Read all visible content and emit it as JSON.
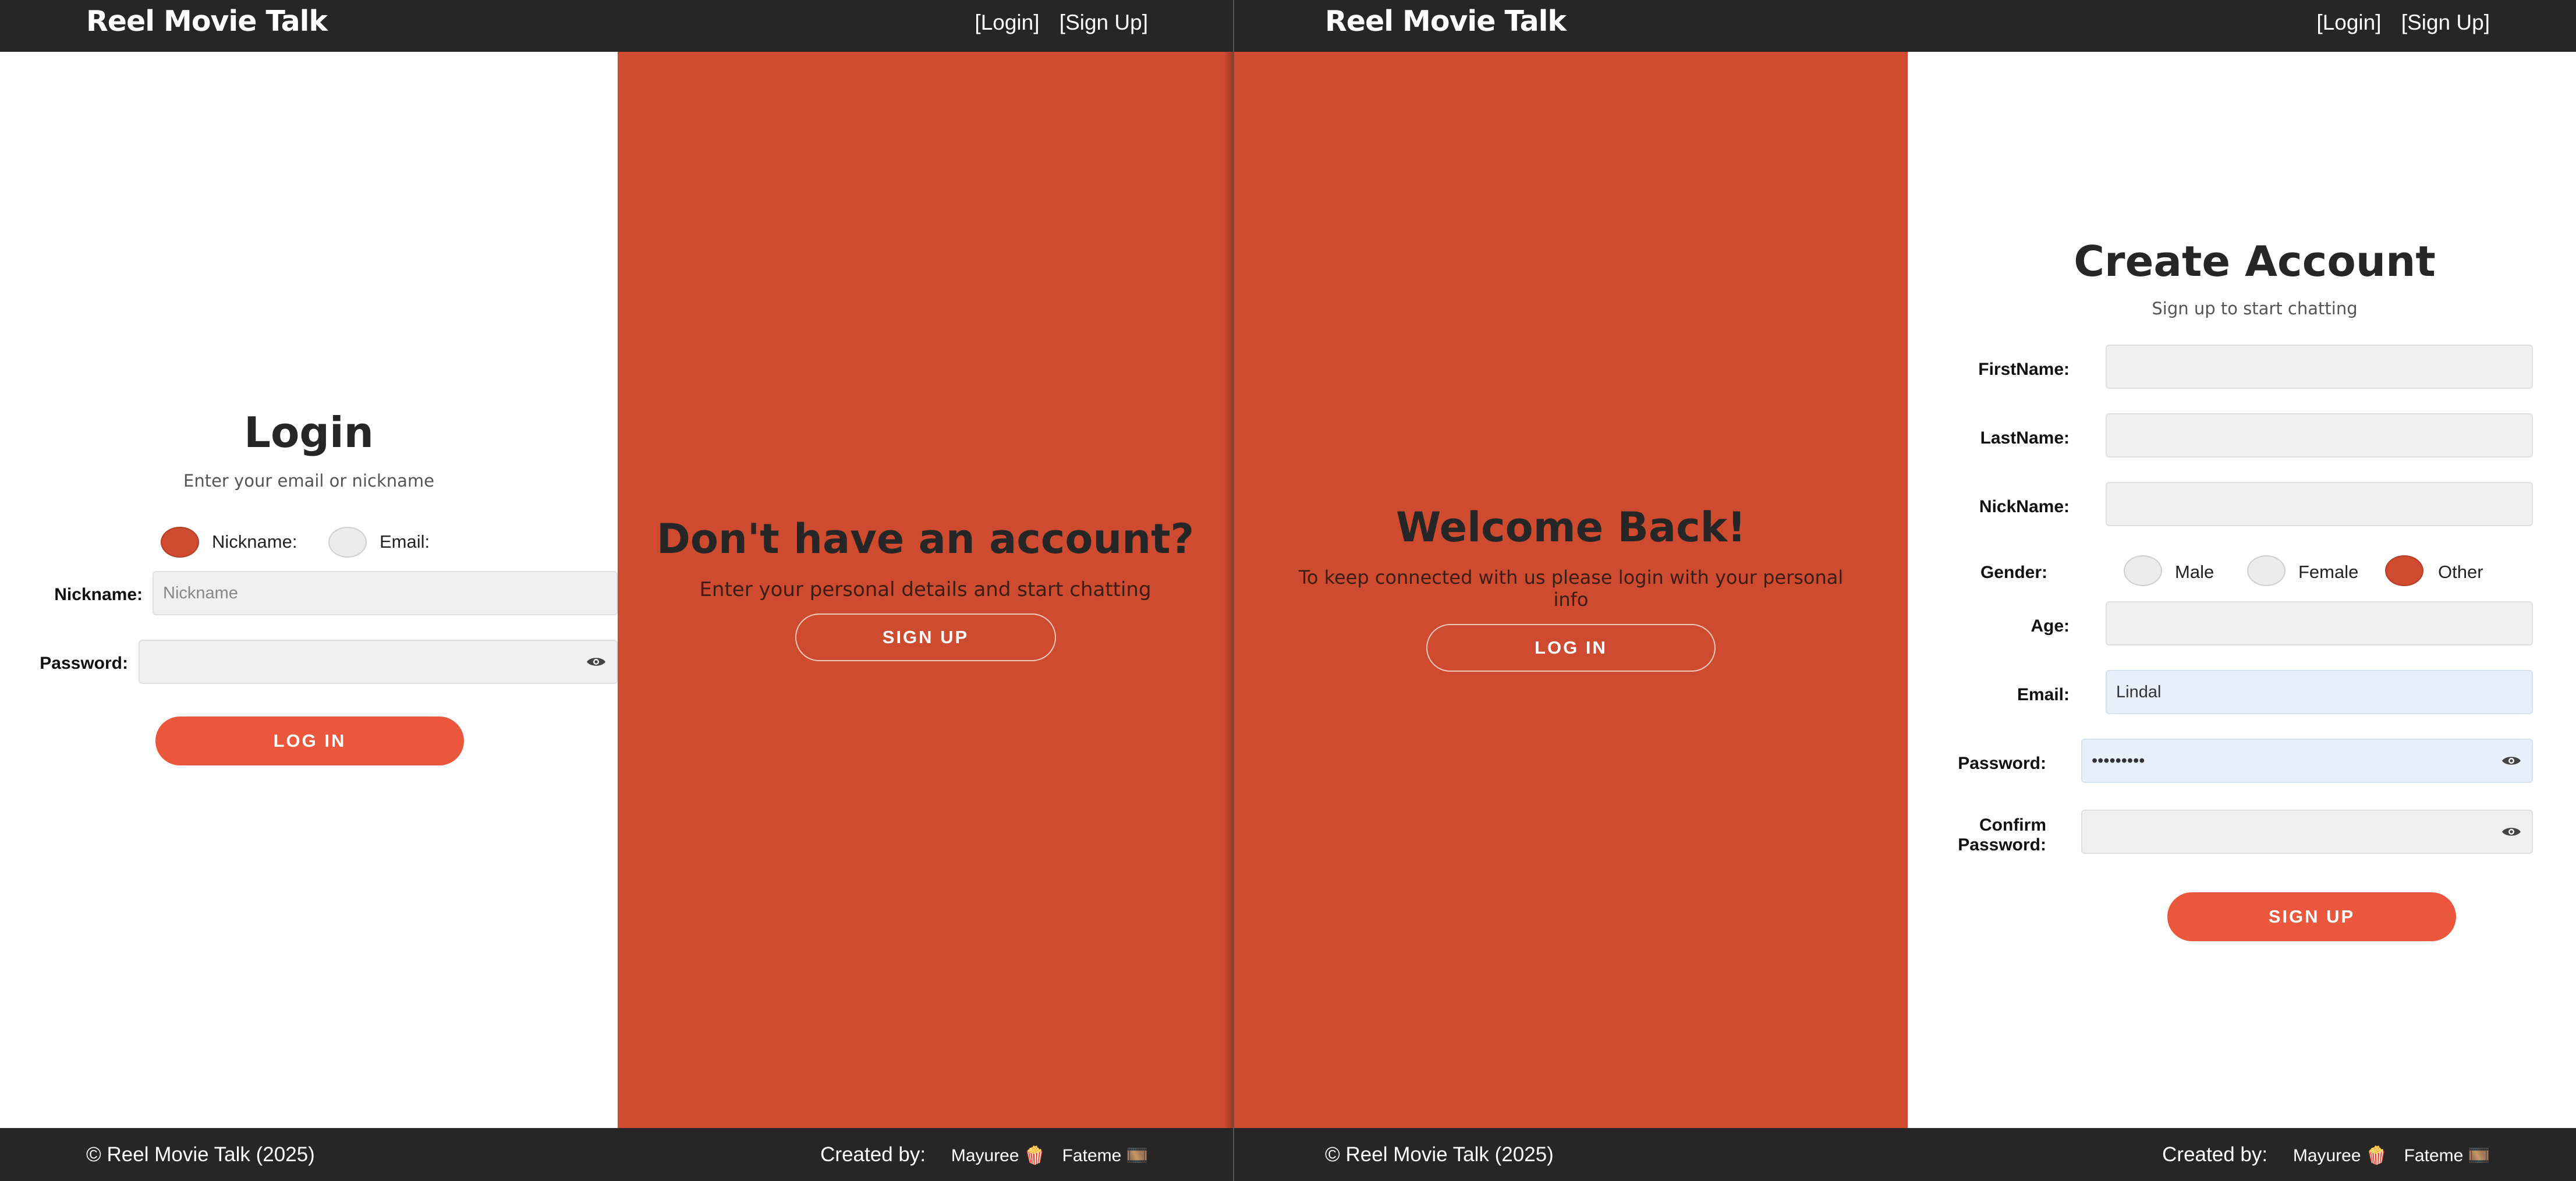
{
  "brand": "Reel Movie Talk",
  "nav": {
    "login": "[Login]",
    "signup": "[Sign Up]"
  },
  "footer": {
    "copyright": "© Reel Movie Talk (2025)",
    "created_by": "Created by:",
    "author1": "Mayuree 🍿",
    "author2": "Fateme 🎞️"
  },
  "login": {
    "title": "Login",
    "subtitle": "Enter your email or nickname",
    "radio_nickname": "Nickname:",
    "radio_email": "Email:",
    "selected_mode": "Nickname",
    "nickname_label": "Nickname:",
    "nickname_placeholder": "Nickname",
    "password_label": "Password:",
    "button": "LOG IN"
  },
  "signup_prompt": {
    "title": "Don't have an account?",
    "subtitle": "Enter your personal details and start chatting",
    "button": "SIGN UP"
  },
  "welcome": {
    "title": "Welcome Back!",
    "subtitle": "To keep connected with us please login with your personal info",
    "button": "LOG IN"
  },
  "create": {
    "title": "Create Account",
    "subtitle": "Sign up to start chatting",
    "firstname_label": "FirstName:",
    "lastname_label": "LastName:",
    "nickname_label": "NickName:",
    "gender_label": "Gender:",
    "gender_options": [
      "Male",
      "Female",
      "Other"
    ],
    "gender_selected": "Other",
    "age_label": "Age:",
    "email_label": "Email:",
    "email_value": "Lindal",
    "password_label": "Password:",
    "password_value": "•••••••••",
    "confirm_label_1": "Confirm",
    "confirm_label_2": "Password:",
    "button": "SIGN UP"
  },
  "colors": {
    "accent": "#cf4b30",
    "button": "#ea573c",
    "nav": "#262626"
  }
}
